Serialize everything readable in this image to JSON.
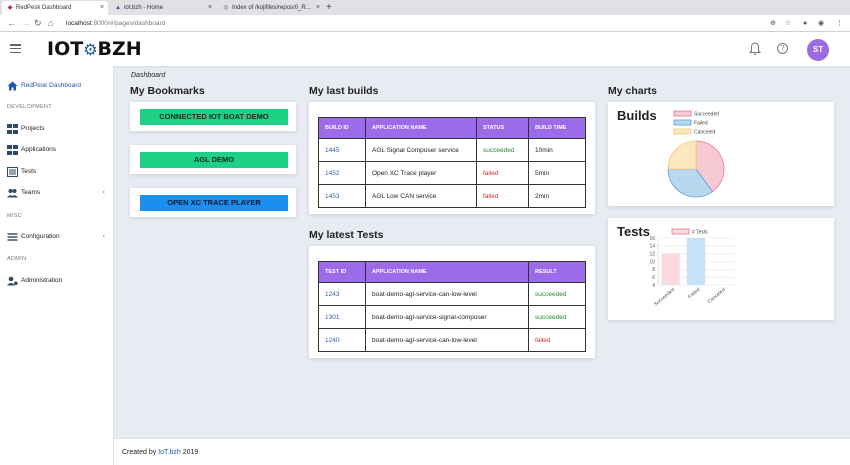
{
  "browser": {
    "tabs": [
      {
        "title": "RedPesk Dashboard"
      },
      {
        "title": "iot.bzh - Home"
      },
      {
        "title": "Index of /kojifiles/repos/0_R..."
      }
    ],
    "url_host": "localhost",
    "url_path": ":8000/#/pages/dashboard"
  },
  "header": {
    "logo_left": "IOT",
    "logo_right": "BZH",
    "avatar_initials": "ST"
  },
  "sidebar": {
    "primary": "RedPesk Dashboard",
    "sections": [
      {
        "label": "DEVELOPMENT"
      },
      {
        "label": "MISC"
      },
      {
        "label": "ADMIN"
      }
    ],
    "items": [
      {
        "label": "Projects"
      },
      {
        "label": "Applications"
      },
      {
        "label": "Tests"
      },
      {
        "label": "Teams"
      },
      {
        "label": "Configuration"
      },
      {
        "label": "Administration"
      }
    ]
  },
  "breadcrumb": "Dashboard",
  "bookmarks": {
    "title": "My Bookmarks",
    "items": [
      {
        "label": "CONNECTED IOT BOAT DEMO"
      },
      {
        "label": "AGL DEMO"
      },
      {
        "label": "OPEN XC TRACE PLAYER"
      }
    ]
  },
  "builds": {
    "title": "My last builds",
    "headers": [
      "BUILD ID",
      "APPLICATION NAME",
      "STATUS",
      "BUILD TIME"
    ],
    "rows": [
      {
        "id": "1445",
        "app": "AGL Signal Composer service",
        "status": "succeeded",
        "time": "10min"
      },
      {
        "id": "1452",
        "app": "Open XC Trace player",
        "status": "failed",
        "time": "5min"
      },
      {
        "id": "1453",
        "app": "AGL Low CAN service",
        "status": "failed",
        "time": "2min"
      }
    ]
  },
  "tests": {
    "title": "My latest Tests",
    "headers": [
      "TEST ID",
      "APPLICATION NAME",
      "RESULT"
    ],
    "rows": [
      {
        "id": "1243",
        "app": "boat-demo-agl-service-can-low-level",
        "result": "succeeded"
      },
      {
        "id": "1301",
        "app": "boat-demo-agl-service-signal-composer",
        "result": "succeeded"
      },
      {
        "id": "1240",
        "app": "boat-demo-agl-service-can-low-level",
        "result": "failed"
      }
    ]
  },
  "charts_title": "My charts",
  "chart_data": [
    {
      "type": "pie",
      "title": "Builds",
      "categories": [
        "Succeeded",
        "Failed",
        "Canceled"
      ],
      "values": [
        40,
        35,
        25
      ],
      "colors": [
        "#f7c9d2",
        "#b8d8f0",
        "#fbe8c0"
      ],
      "borders": [
        "#e8788f",
        "#5aa0d8",
        "#f0c870"
      ]
    },
    {
      "type": "bar",
      "title": "Tests",
      "categories": [
        "Succeeded",
        "Failed",
        "Canceled"
      ],
      "series": [
        {
          "name": "# Tests",
          "values": [
            12,
            16,
            0
          ]
        }
      ],
      "yticks": [
        "16",
        "14",
        "12",
        "10",
        "8",
        "6",
        "4"
      ],
      "ylim": [
        4,
        16
      ],
      "colors": [
        "#fbd9e0",
        "#c6e2f6",
        "#fbecd0"
      ]
    }
  ],
  "footer": {
    "prefix": "Created by ",
    "brand": "IoT.bzh",
    "suffix": " 2019"
  }
}
